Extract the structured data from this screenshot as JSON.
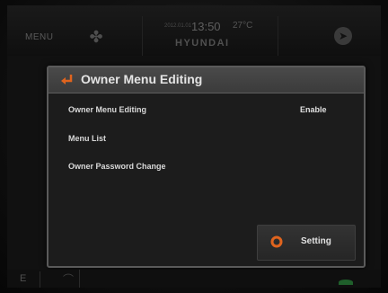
{
  "topbar": {
    "menu_label": "MENU",
    "date": "2012.01.01",
    "time": "13:50",
    "temperature": "27°C",
    "brand": "HYUNDAI",
    "fan_icon": "fan-icon",
    "nav_icon": "navigation-icon"
  },
  "dialog": {
    "title": "Owner Menu Editing",
    "back_icon": "back-arrow-icon",
    "rows": [
      {
        "label": "Owner Menu Editing",
        "value": "Enable"
      },
      {
        "label": "Menu List"
      },
      {
        "label": "Owner Password Change"
      }
    ],
    "setting_button": {
      "label": "Setting",
      "icon": "gear-icon"
    }
  },
  "bottom": {
    "left_label": "E"
  },
  "colors": {
    "accent_orange": "#e0641e",
    "header_gray": "#454545",
    "status_green": "#1f5f2b"
  }
}
